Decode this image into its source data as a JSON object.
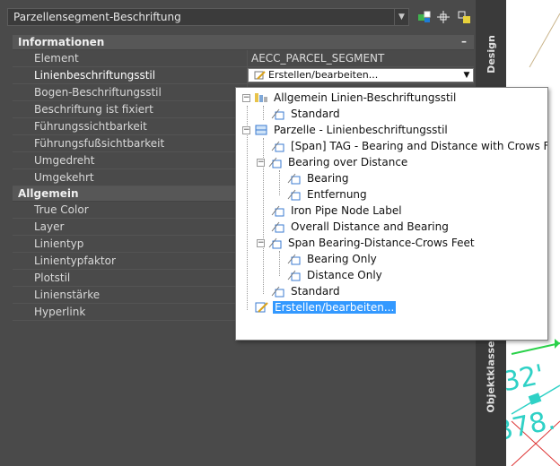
{
  "selector": {
    "value": "Parzellensegment-Beschriftung"
  },
  "toolbar": {
    "icons": [
      "quick-select-icon",
      "pick-point-icon",
      "select-objects-icon"
    ]
  },
  "categories": {
    "info": {
      "label": "Informationen",
      "collapse": "–"
    },
    "general": {
      "label": "Allgemein"
    }
  },
  "info_rows": [
    {
      "name": "Element",
      "value": "AECC_PARCEL_SEGMENT"
    },
    {
      "name": "Linienbeschriftungsstil",
      "value": "Erstellen/bearbeiten..."
    },
    {
      "name": "Bogen-Beschriftungsstil",
      "value": ""
    },
    {
      "name": "Beschriftung ist fixiert",
      "value": ""
    },
    {
      "name": "Führungssichtbarkeit",
      "value": ""
    },
    {
      "name": "Führungsfußsichtbarkeit",
      "value": ""
    },
    {
      "name": "Umgedreht",
      "value": ""
    },
    {
      "name": "Umgekehrt",
      "value": ""
    }
  ],
  "general_rows": [
    {
      "name": "True Color",
      "value": ""
    },
    {
      "name": "Layer",
      "value": ""
    },
    {
      "name": "Linientyp",
      "value": ""
    },
    {
      "name": "Linientypfaktor",
      "value": ""
    },
    {
      "name": "Plotstil",
      "value": ""
    },
    {
      "name": "Linienstärke",
      "value": ""
    },
    {
      "name": "Hyperlink",
      "value": ""
    }
  ],
  "side_tabs": {
    "design": "Design",
    "objektklasse": "Objektklasse"
  },
  "tree": [
    {
      "label": "Allgemein Linien-Beschriftungsstil",
      "expander": "−"
    },
    {
      "label": "Standard"
    },
    {
      "label": "Parzelle - Linienbeschriftungsstil",
      "expander": "−"
    },
    {
      "label": "[Span] TAG - Bearing and Distance with Crows Feet"
    },
    {
      "label": "Bearing over Distance",
      "expander": "−"
    },
    {
      "label": "Bearing"
    },
    {
      "label": "Entfernung"
    },
    {
      "label": "Iron Pipe Node Label"
    },
    {
      "label": "Overall Distance and Bearing"
    },
    {
      "label": "Span Bearing-Distance-Crows Feet",
      "expander": "−"
    },
    {
      "label": "Bearing Only"
    },
    {
      "label": "Distance Only"
    },
    {
      "label": "Standard"
    },
    {
      "label": "Erstellen/bearbeiten..."
    }
  ],
  "drawing": {
    "texts": [
      "32'",
      "378."
    ],
    "accent": "#2fd1c6"
  }
}
